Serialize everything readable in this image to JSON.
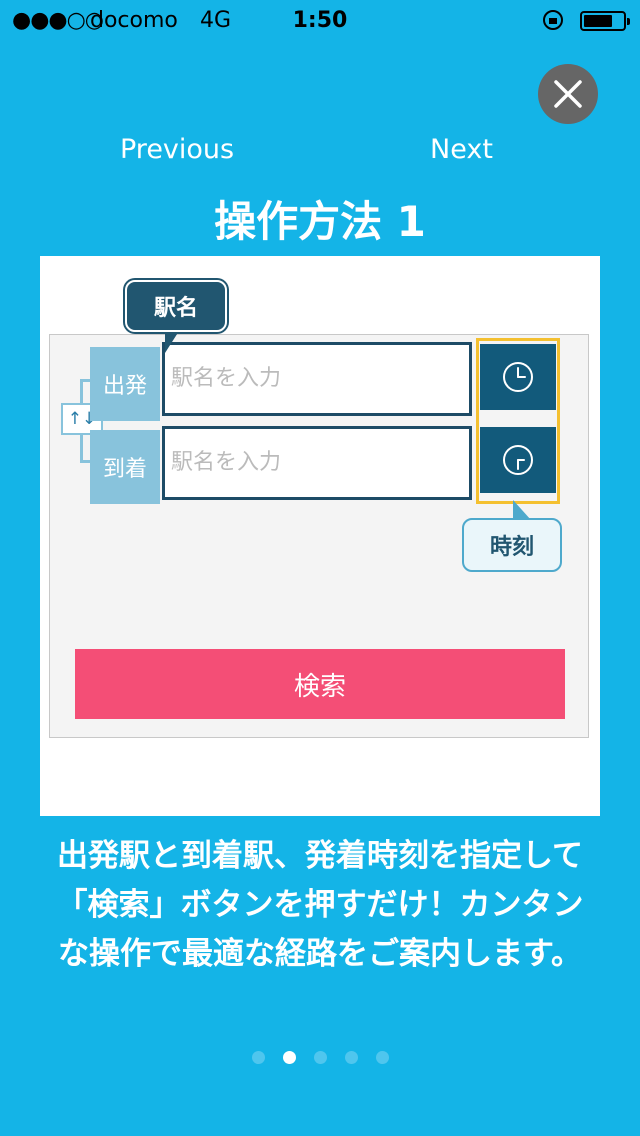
{
  "status_bar": {
    "signal": "●●●○○",
    "carrier": "docomo",
    "network": "4G",
    "time": "1:50"
  },
  "nav": {
    "previous": "Previous",
    "next": "Next"
  },
  "title": "操作方法 1",
  "illustration": {
    "callout_station": "駅名",
    "callout_time": "時刻",
    "departure_label": "出発",
    "arrival_label": "到着",
    "departure_placeholder": "駅名を入力",
    "arrival_placeholder": "駅名を入力",
    "swap_symbol": "↑↓",
    "search_label": "検索"
  },
  "description": "出発駅と到着駅、発着時刻を指定して「検索」ボタンを押すだけ！カンタンな操作で最適な経路をご案内します。",
  "pager": {
    "count": 5,
    "active_index": 1
  },
  "colors": {
    "background": "#14b4e7",
    "accent_dark": "#125a7b",
    "search_button": "#f44e76",
    "highlight": "#f4c030"
  },
  "icons": [
    "close-icon",
    "clock-icon",
    "swap-icon",
    "lock-icon",
    "battery-icon"
  ]
}
